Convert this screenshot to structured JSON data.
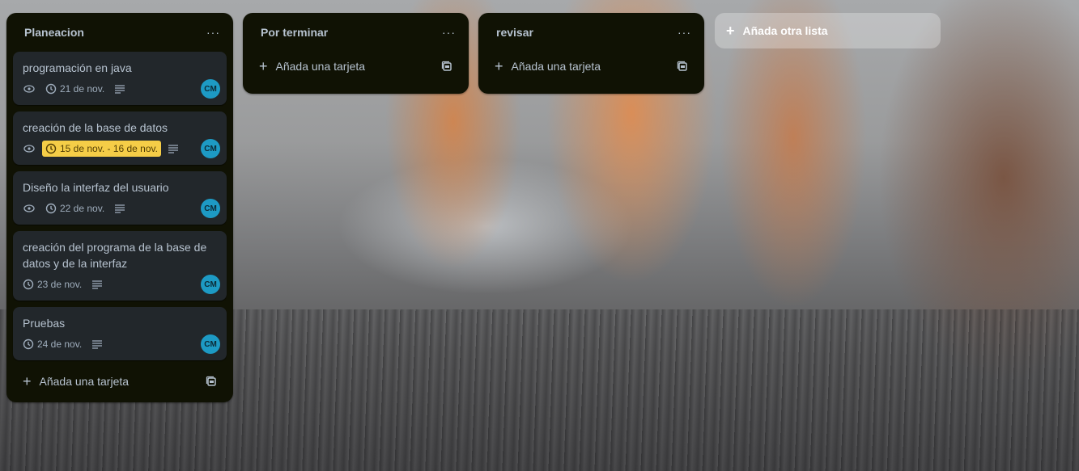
{
  "lists": [
    {
      "title": "Planeacion",
      "menu": "···",
      "cards": [
        {
          "title": "programación en java",
          "date": "21 de nov.",
          "avatar": "CM",
          "watch": true
        },
        {
          "title": "creación de la base de datos",
          "date": "15 de nov. - 16 de nov.",
          "avatar": "CM",
          "watch": true,
          "due": true
        },
        {
          "title": "Diseño la interfaz del usuario",
          "date": "22 de nov.",
          "avatar": "CM",
          "watch": true
        },
        {
          "title": "creación del programa de la base de datos y de la interfaz",
          "date": "23 de nov.",
          "avatar": "CM",
          "watch": false
        },
        {
          "title": "Pruebas",
          "date": "24 de nov.",
          "avatar": "CM",
          "watch": false
        }
      ],
      "add_label": "Añada una tarjeta"
    },
    {
      "title": "Por terminar",
      "menu": "···",
      "cards": [],
      "add_label": "Añada una tarjeta"
    },
    {
      "title": "revisar",
      "menu": "···",
      "cards": [],
      "add_label": "Añada una tarjeta"
    }
  ],
  "add_list_label": "Añada otra lista",
  "colors": {
    "list_bg": "#101204",
    "card_bg": "#22272b",
    "due_yellow": "#f5cd47",
    "avatar": "#1d9ac4"
  }
}
